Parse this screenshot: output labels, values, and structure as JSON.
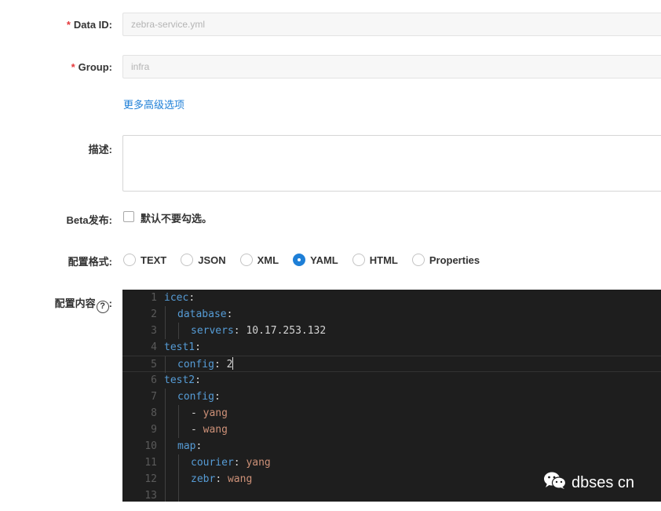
{
  "form": {
    "data_id": {
      "required_mark": "*",
      "label": "Data ID:",
      "value": "zebra-service.yml"
    },
    "group": {
      "required_mark": "*",
      "label": "Group:",
      "value": "infra"
    },
    "advanced_link": "更多高级选项",
    "description": {
      "label": "描述:",
      "value": ""
    },
    "beta": {
      "label": "Beta发布:",
      "checkbox_text": "默认不要勾选。",
      "checked": false
    },
    "format": {
      "label": "配置格式:",
      "options": [
        "TEXT",
        "JSON",
        "XML",
        "YAML",
        "HTML",
        "Properties"
      ],
      "selected": "YAML"
    },
    "content": {
      "label": "配置内容",
      "help_icon": "?",
      "label_suffix": ":"
    }
  },
  "editor": {
    "lines": [
      {
        "num": "1",
        "key": "icec",
        "sep": ":",
        "value": ""
      },
      {
        "num": "2",
        "key": "database",
        "sep": ":",
        "value": ""
      },
      {
        "num": "3",
        "key": "servers",
        "sep": ": ",
        "value": "10.17.253.132"
      },
      {
        "num": "4",
        "key": "test1",
        "sep": ":",
        "value": ""
      },
      {
        "num": "5",
        "key": "config",
        "sep": ": ",
        "value": "2"
      },
      {
        "num": "6",
        "key": "test2",
        "sep": ":",
        "value": ""
      },
      {
        "num": "7",
        "key": "config",
        "sep": ":",
        "value": ""
      },
      {
        "num": "8",
        "key": "",
        "sep": "- ",
        "value": "yang"
      },
      {
        "num": "9",
        "key": "",
        "sep": "- ",
        "value": "wang"
      },
      {
        "num": "10",
        "key": "map",
        "sep": ":",
        "value": ""
      },
      {
        "num": "11",
        "key": "courier",
        "sep": ": ",
        "value": "yang"
      },
      {
        "num": "12",
        "key": "zebr",
        "sep": ": ",
        "value": "wang"
      },
      {
        "num": "13",
        "key": "",
        "sep": "",
        "value": ""
      }
    ]
  },
  "watermark": {
    "icon": "wechat-icon",
    "text": "dbses cn"
  },
  "colors": {
    "primary": "#1e7fd7",
    "required": "#e4393c",
    "editor_bg": "#1e1e1e",
    "yaml_key": "#569cd6",
    "yaml_value": "#ce9178"
  }
}
